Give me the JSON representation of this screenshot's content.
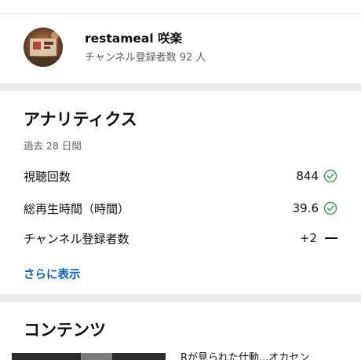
{
  "channel": {
    "name": "restameal 咲楽",
    "subscribers": "チャンネル登録者数 92 人"
  },
  "analytics": {
    "title": "アナリティクス",
    "period": "過去 28 日間",
    "metrics": [
      {
        "label": "視聴回数",
        "value": "844",
        "status": "check-icon"
      },
      {
        "label": "総再生時間（時間）",
        "value": "39.6",
        "status": "check-icon"
      },
      {
        "label": "チャンネル登録者数",
        "value": "+2",
        "status": "dash-icon"
      }
    ],
    "more_label": "さらに表示"
  },
  "contents": {
    "title": "コンテンツ",
    "first_caption": "Rが見られた仕動...オカセン"
  },
  "colors": {
    "accent_link": "#065fd4",
    "check_green": "#2ba640",
    "divider": "#ececec",
    "secondary_text": "#606060"
  }
}
